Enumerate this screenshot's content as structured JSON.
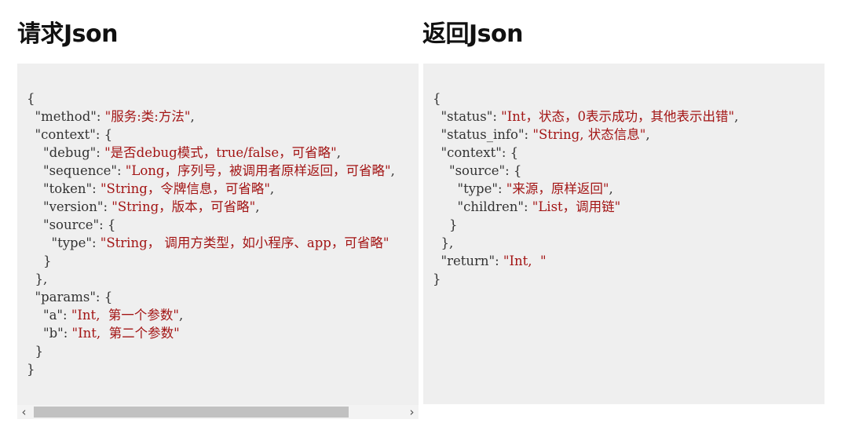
{
  "headings": {
    "request": "请求Json",
    "response": "返回Json"
  },
  "request_json": {
    "lines": [
      [
        {
          "t": "{"
        }
      ],
      [
        {
          "t": "  "
        },
        {
          "k": "\"method\""
        },
        {
          "t": ": "
        },
        {
          "s": "\"服务:类:方法\""
        },
        {
          "t": ","
        }
      ],
      [
        {
          "t": "  "
        },
        {
          "k": "\"context\""
        },
        {
          "t": ": {"
        }
      ],
      [
        {
          "t": "    "
        },
        {
          "k": "\"debug\""
        },
        {
          "t": ": "
        },
        {
          "s": "\"是否debug模式，true/false，可省略\""
        },
        {
          "t": ","
        }
      ],
      [
        {
          "t": "    "
        },
        {
          "k": "\"sequence\""
        },
        {
          "t": ": "
        },
        {
          "s": "\"Long，序列号，被调用者原样返回，可省略\""
        },
        {
          "t": ","
        }
      ],
      [
        {
          "t": "    "
        },
        {
          "k": "\"token\""
        },
        {
          "t": ": "
        },
        {
          "s": "\"String，令牌信息，可省略\""
        },
        {
          "t": ","
        }
      ],
      [
        {
          "t": "    "
        },
        {
          "k": "\"version\""
        },
        {
          "t": ": "
        },
        {
          "s": "\"String，版本，可省略\""
        },
        {
          "t": ","
        }
      ],
      [
        {
          "t": "    "
        },
        {
          "k": "\"source\""
        },
        {
          "t": ": {"
        }
      ],
      [
        {
          "t": "      "
        },
        {
          "k": "\"type\""
        },
        {
          "t": ": "
        },
        {
          "s": "\"String， 调用方类型，如小程序、app，可省略\""
        }
      ],
      [
        {
          "t": "    }"
        }
      ],
      [
        {
          "t": "  },"
        }
      ],
      [
        {
          "t": "  "
        },
        {
          "k": "\"params\""
        },
        {
          "t": ": {"
        }
      ],
      [
        {
          "t": "    "
        },
        {
          "k": "\"a\""
        },
        {
          "t": ": "
        },
        {
          "s": "\"Int,  第一个参数\""
        },
        {
          "t": ","
        }
      ],
      [
        {
          "t": "    "
        },
        {
          "k": "\"b\""
        },
        {
          "t": ": "
        },
        {
          "s": "\"Int,  第二个参数\""
        }
      ],
      [
        {
          "t": "  }"
        }
      ],
      [
        {
          "t": "}"
        }
      ]
    ]
  },
  "response_json": {
    "lines": [
      [
        {
          "t": "{"
        }
      ],
      [
        {
          "t": "  "
        },
        {
          "k": "\"status\""
        },
        {
          "t": ": "
        },
        {
          "s": "\"Int，状态，0表示成功，其他表示出错\""
        },
        {
          "t": ","
        }
      ],
      [
        {
          "t": "  "
        },
        {
          "k": "\"status_info\""
        },
        {
          "t": ": "
        },
        {
          "s": "\"String, 状态信息\""
        },
        {
          "t": ","
        }
      ],
      [
        {
          "t": "  "
        },
        {
          "k": "\"context\""
        },
        {
          "t": ": {"
        }
      ],
      [
        {
          "t": "    "
        },
        {
          "k": "\"source\""
        },
        {
          "t": ": {"
        }
      ],
      [
        {
          "t": "      "
        },
        {
          "k": "\"type\""
        },
        {
          "t": ": "
        },
        {
          "s": "\"来源，原样返回\""
        },
        {
          "t": ","
        }
      ],
      [
        {
          "t": "      "
        },
        {
          "k": "\"children\""
        },
        {
          "t": ": "
        },
        {
          "s": "\"List，调用链\""
        }
      ],
      [
        {
          "t": "    }"
        }
      ],
      [
        {
          "t": "  },"
        }
      ],
      [
        {
          "t": "  "
        },
        {
          "k": "\"return\""
        },
        {
          "t": ": "
        },
        {
          "s": "\"Int,  \""
        }
      ],
      [
        {
          "t": "}"
        }
      ]
    ]
  },
  "scrollbar": {
    "left_arrow": "‹",
    "right_arrow": "›",
    "visible_fraction": 0.78,
    "position_fraction": 0.0
  },
  "colors": {
    "panel_bg": "#efefef",
    "string": "#a31515",
    "key": "#333333"
  }
}
